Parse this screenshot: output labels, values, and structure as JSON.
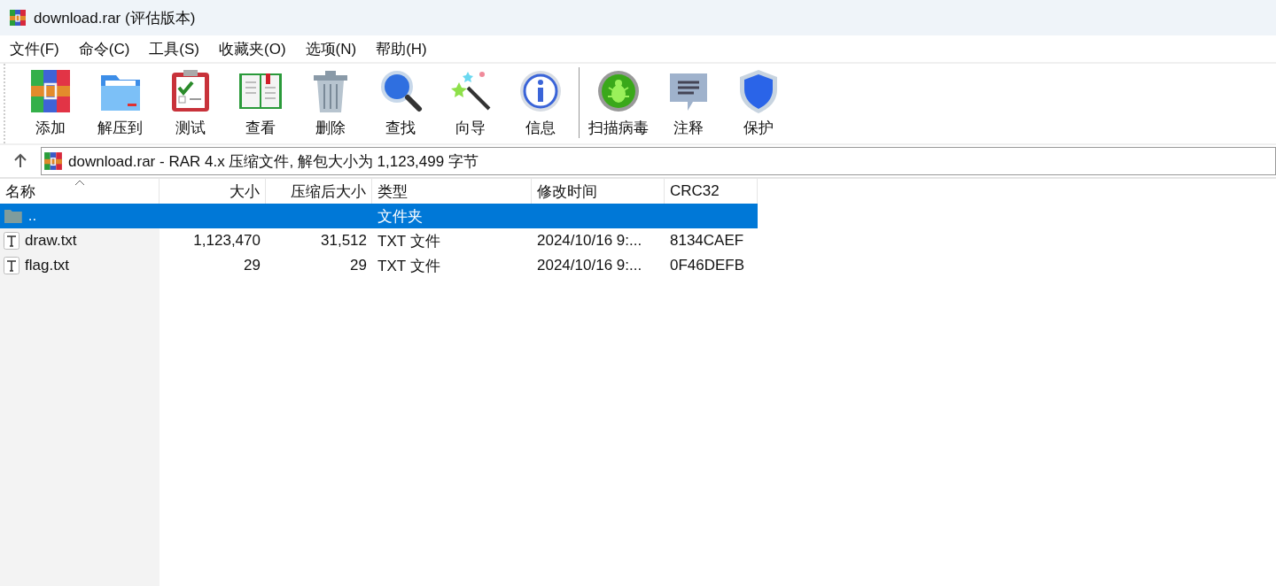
{
  "window": {
    "title": "download.rar (评估版本)"
  },
  "menu": [
    "文件(F)",
    "命令(C)",
    "工具(S)",
    "收藏夹(O)",
    "选项(N)",
    "帮助(H)"
  ],
  "toolbar": [
    {
      "kind": "add",
      "label": "添加"
    },
    {
      "kind": "extract",
      "label": "解压到"
    },
    {
      "kind": "test",
      "label": "测试"
    },
    {
      "kind": "view",
      "label": "查看"
    },
    {
      "kind": "delete",
      "label": "删除"
    },
    {
      "kind": "find",
      "label": "查找"
    },
    {
      "kind": "wizard",
      "label": "向导"
    },
    {
      "kind": "info",
      "label": "信息"
    },
    {
      "kind": "separator"
    },
    {
      "kind": "virus",
      "label": "扫描病毒"
    },
    {
      "kind": "comment",
      "label": "注释"
    },
    {
      "kind": "protect",
      "label": "保护"
    }
  ],
  "address": {
    "text": "download.rar - RAR 4.x 压缩文件, 解包大小为 1,123,499 字节"
  },
  "table": {
    "columns": [
      {
        "label": "名称",
        "sorted": true
      },
      {
        "label": "大小",
        "sorted": false
      },
      {
        "label": "压缩后大小",
        "sorted": false
      },
      {
        "label": "类型",
        "sorted": false
      },
      {
        "label": "修改时间",
        "sorted": false
      },
      {
        "label": "CRC32",
        "sorted": false
      }
    ],
    "rows": [
      {
        "kind": "folder",
        "selected": true,
        "cells": [
          "..",
          "",
          "",
          "文件夹",
          "",
          ""
        ]
      },
      {
        "kind": "file",
        "selected": false,
        "cells": [
          "draw.txt",
          "1,123,470",
          "31,512",
          "TXT 文件",
          "2024/10/16 9:...",
          "8134CAEF"
        ]
      },
      {
        "kind": "file",
        "selected": false,
        "cells": [
          "flag.txt",
          "29",
          "29",
          "TXT 文件",
          "2024/10/16 9:...",
          "0F46DEFB"
        ]
      }
    ]
  }
}
